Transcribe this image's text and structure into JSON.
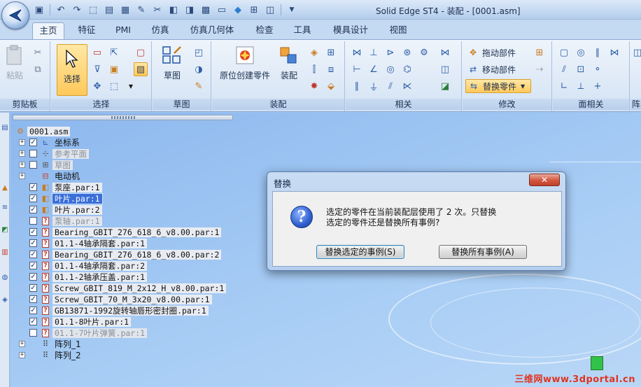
{
  "window": {
    "title": "Solid Edge ST4 - 装配 - [0001.asm]"
  },
  "tabs": [
    {
      "label": "主页",
      "active": true
    },
    {
      "label": "特征"
    },
    {
      "label": "PMI"
    },
    {
      "label": "仿真"
    },
    {
      "label": "仿真几何体"
    },
    {
      "label": "检查"
    },
    {
      "label": "工具"
    },
    {
      "label": "模具设计"
    },
    {
      "label": "视图"
    }
  ],
  "ribbon": {
    "groups": {
      "clipboard": "剪贴板",
      "select": "选择",
      "sketch": "草图",
      "assembly": "装配",
      "relations": "相关",
      "modify": "修改",
      "face_relations": "面相关",
      "cut": "阵"
    },
    "buttons": {
      "paste": "粘贴",
      "select": "选择",
      "sketch": "草图",
      "create_in_place": "原位创建零件",
      "assemble": "装配",
      "drag_component": "拖动部件",
      "move_component": "移动部件",
      "replace_part": "替换零件"
    }
  },
  "tree": {
    "root": "0001.asm",
    "items": [
      {
        "label": "坐标系",
        "checked": true,
        "plus": true,
        "style": "cjk"
      },
      {
        "label": "参考平面",
        "checked": false,
        "plus": true,
        "style": "dim"
      },
      {
        "label": "草图",
        "checked": false,
        "plus": true,
        "style": "dim"
      },
      {
        "label": "电动机",
        "checked": null,
        "plus": true,
        "style": "cjk"
      },
      {
        "label": "泵座.par:1",
        "checked": true,
        "plus": false,
        "style": "normal"
      },
      {
        "label": "叶片.par:1",
        "checked": true,
        "plus": false,
        "style": "sel"
      },
      {
        "label": "叶片.par:2",
        "checked": true,
        "plus": false,
        "style": "normal"
      },
      {
        "label": "泵轴.par:1",
        "checked": false,
        "plus": false,
        "style": "dim"
      },
      {
        "label": "Bearing_GBIT_276_618_6_v8.00.par:1",
        "checked": true,
        "plus": false,
        "style": "normal"
      },
      {
        "label": "01.1-4轴承隔套.par:1",
        "checked": true,
        "plus": false,
        "style": "normal"
      },
      {
        "label": "Bearing_GBIT_276_618_6_v8.00.par:2",
        "checked": true,
        "plus": false,
        "style": "normal"
      },
      {
        "label": "01.1-4轴承隔套.par:2",
        "checked": true,
        "plus": false,
        "style": "normal"
      },
      {
        "label": "01.1-2轴承压盖.par:1",
        "checked": true,
        "plus": false,
        "style": "normal"
      },
      {
        "label": "Screw_GBIT_819_M_2x12_H_v8.00.par:1",
        "checked": true,
        "plus": false,
        "style": "normal"
      },
      {
        "label": "Screw_GBIT_70_M_3x20_v8.00.par:1",
        "checked": true,
        "plus": false,
        "style": "normal"
      },
      {
        "label": "GB13871-1992旋转轴唇形密封圈.par:1",
        "checked": true,
        "plus": false,
        "style": "normal"
      },
      {
        "label": "01.1-8叶片.par:1",
        "checked": true,
        "plus": false,
        "style": "normal"
      },
      {
        "label": "01.1-7叶片弹簧.par:1",
        "checked": false,
        "plus": false,
        "style": "dim"
      },
      {
        "label": "阵列_1",
        "checked": null,
        "plus": true,
        "style": "cjk"
      },
      {
        "label": "阵列_2",
        "checked": null,
        "plus": true,
        "style": "cjk"
      }
    ]
  },
  "dialog": {
    "title": "替换",
    "close": "✕",
    "message_line1": "选定的零件在当前装配层使用了 2 次。只替换",
    "message_line2": "选定的零件还是替换所有事例?",
    "btn_selected": "替换选定的事例(S)",
    "btn_all": "替换所有事例(A)"
  },
  "watermark": "三维网www.3dportal.cn",
  "colors": {
    "accent": "#3a6fd8",
    "canvas": "#a8cdf5",
    "highlight": "#ffc95a"
  }
}
